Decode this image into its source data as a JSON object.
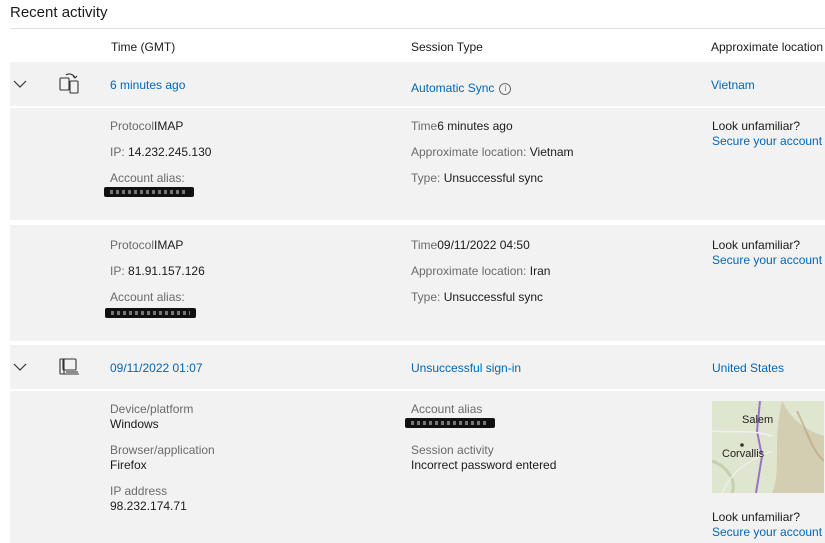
{
  "title": "Recent activity",
  "columns": {
    "time": "Time (GMT)",
    "session": "Session Type",
    "location": "Approximate location"
  },
  "row1": {
    "time": "6 minutes ago",
    "session": "Automatic Sync",
    "location": "Vietnam",
    "d1": {
      "protocol_label": "Protocol",
      "protocol_value": "IMAP",
      "ip_label": "IP: ",
      "ip_value": "14.232.245.130",
      "alias_label": "Account alias:",
      "time_label": "Time",
      "time_value": "6 minutes ago",
      "loc_label": "Approximate location: ",
      "loc_value": "Vietnam",
      "type_label": "Type: ",
      "type_value": "Unsuccessful sync",
      "unfamiliar": "Look unfamiliar?",
      "secure": "Secure your account"
    },
    "d2": {
      "protocol_label": "Protocol",
      "protocol_value": "IMAP",
      "ip_label": "IP: ",
      "ip_value": "81.91.157.126",
      "alias_label": "Account alias:",
      "time_label": "Time",
      "time_value": "09/11/2022 04:50",
      "loc_label": "Approximate location: ",
      "loc_value": "Iran",
      "type_label": "Type: ",
      "type_value": "Unsuccessful sync",
      "unfamiliar": "Look unfamiliar?",
      "secure": "Secure your account"
    }
  },
  "row2": {
    "time": "09/11/2022 01:07",
    "session": "Unsuccessful sign-in",
    "location": "United States",
    "detail": {
      "device_label": "Device/platform",
      "device_value": "Windows",
      "browser_label": "Browser/application",
      "browser_value": "Firefox",
      "ip_label": "IP address",
      "ip_value": "98.232.174.71",
      "alias_label": "Account alias",
      "activity_label": "Session activity",
      "activity_value": "Incorrect password entered",
      "map_city1": "Salem",
      "map_city2": "Corvallis",
      "unfamiliar": "Look unfamiliar?",
      "secure": "Secure your account"
    }
  }
}
